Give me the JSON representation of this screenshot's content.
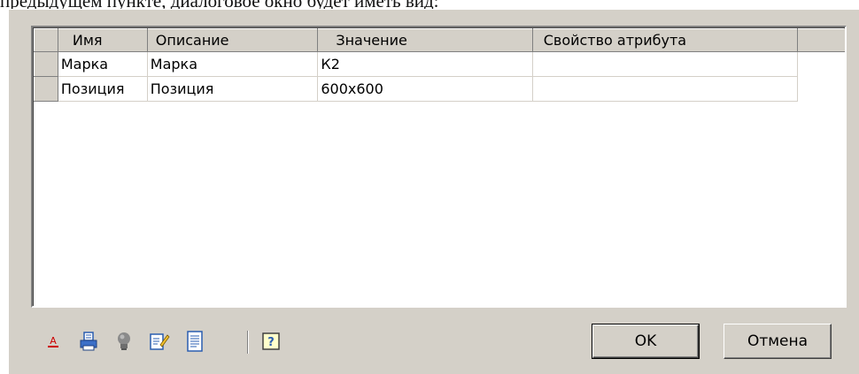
{
  "caption": "предыдущем пункте, диалоговое окно будет иметь вид:",
  "grid": {
    "columns": [
      {
        "key": "name",
        "label": "Имя"
      },
      {
        "key": "description",
        "label": "Описание"
      },
      {
        "key": "value",
        "label": "Значение"
      },
      {
        "key": "attribute_property",
        "label": "Свойство атрибута"
      }
    ],
    "rows": [
      {
        "name": "Марка",
        "description": "Марка",
        "value": "К2",
        "attribute_property": ""
      },
      {
        "name": "Позиция",
        "description": "Позиция",
        "value": "600x600",
        "attribute_property": ""
      }
    ]
  },
  "toolbar": {
    "icons": [
      "text-style-icon",
      "print-icon",
      "lightbulb-icon",
      "edit-icon",
      "document-icon",
      "help-icon"
    ]
  },
  "buttons": {
    "ok_label": "OK",
    "cancel_label": "Отмена"
  },
  "colors": {
    "dialog_bg": "#d4d0c8",
    "grid_bg": "#ffffff",
    "accent_red": "#cc0000",
    "icon_blue": "#2a5db0"
  }
}
